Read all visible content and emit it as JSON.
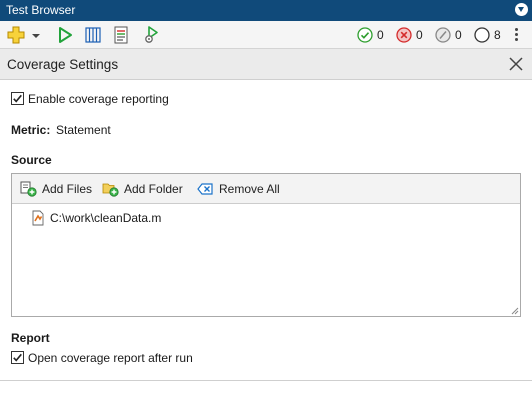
{
  "window": {
    "title": "Test Browser"
  },
  "toolbar": {
    "status": {
      "passed_count": "0",
      "failed_count": "0",
      "incomplete_count": "0",
      "not_run_count": "8"
    }
  },
  "panel": {
    "title": "Coverage Settings",
    "enable_coverage": {
      "label": "Enable coverage reporting",
      "checked": true
    },
    "metric": {
      "label": "Metric:",
      "value": "Statement"
    },
    "source": {
      "heading": "Source",
      "add_files_label": "Add Files",
      "add_folder_label": "Add Folder",
      "remove_all_label": "Remove All",
      "files": [
        "C:\\work\\cleanData.m"
      ]
    },
    "report": {
      "heading": "Report",
      "open_report": {
        "label": "Open coverage report after run",
        "checked": true
      }
    }
  },
  "colors": {
    "titlebar": "#104a7a",
    "passed": "#2e9e2e",
    "failed": "#d42b2b",
    "run": "#22a33b"
  }
}
